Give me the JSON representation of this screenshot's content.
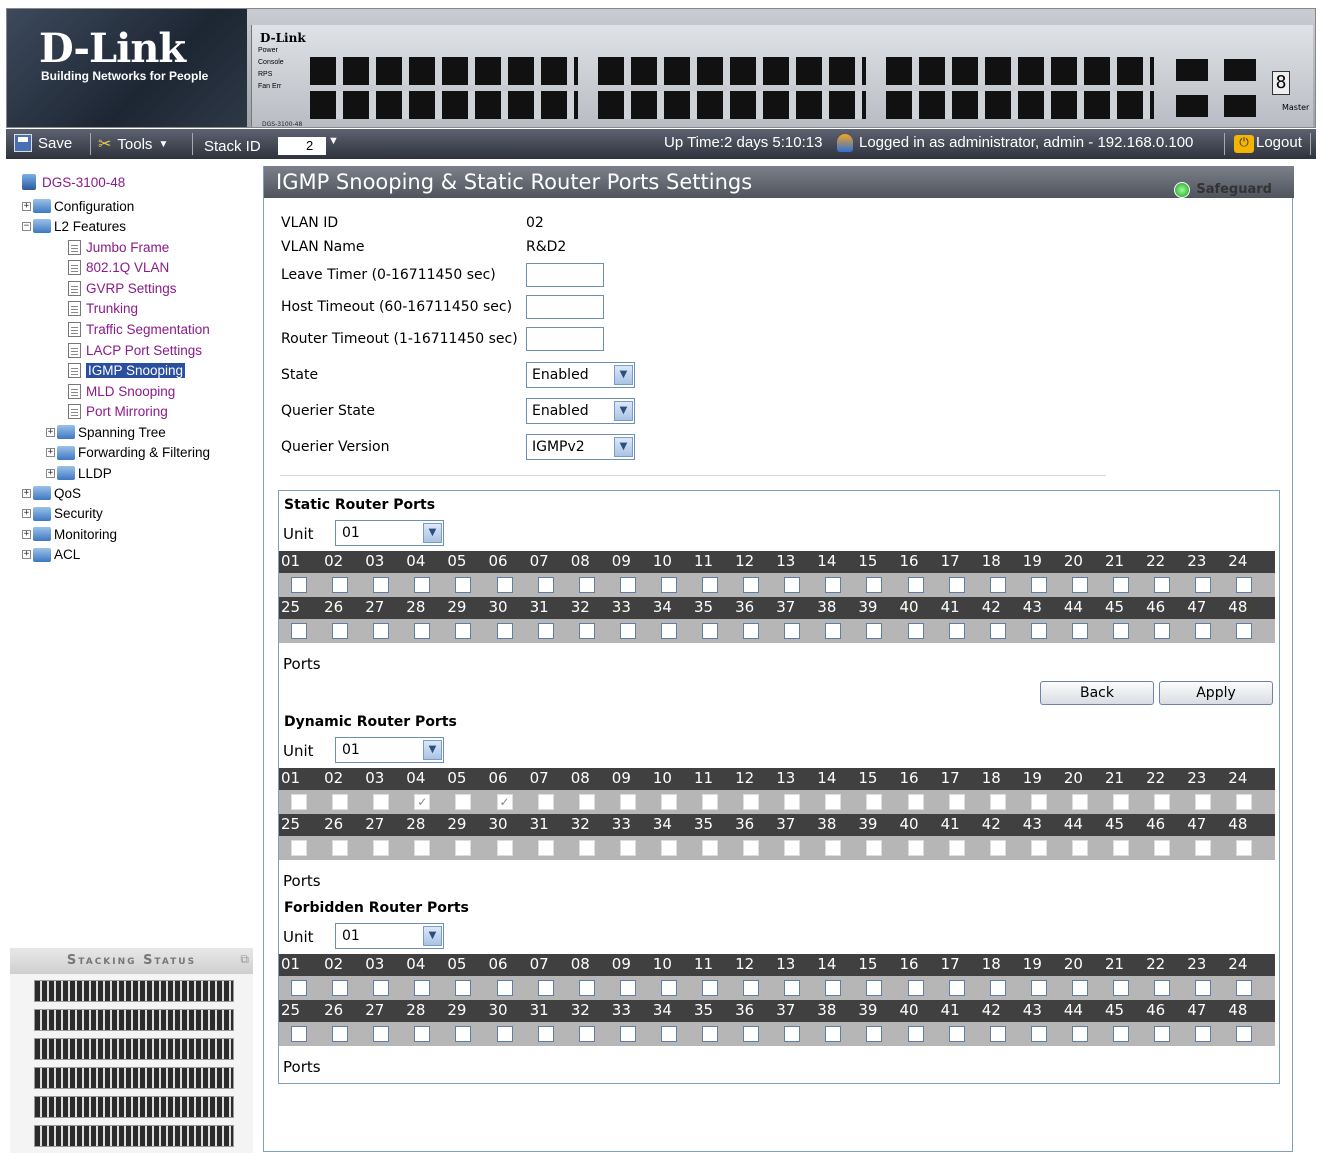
{
  "header": {
    "logo_brand": "D-Link",
    "logo_tagline": "Building Networks for People",
    "switch_brand": "D-Link",
    "switch_model": "DGS-3100-48",
    "led_labels": [
      "Power",
      "Console",
      "RPS",
      "Fan Err"
    ],
    "unit_digit": "8",
    "master_label": "Master"
  },
  "toolbar": {
    "save": "Save",
    "tools": "Tools",
    "stack_id_label": "Stack ID",
    "stack_id_value": "2",
    "uptime": "Up Time:2 days 5:10:13",
    "logged_in": "Logged in as administrator, admin - 192.168.0.100",
    "logout": "Logout"
  },
  "tree": {
    "root": "DGS-3100-48",
    "configuration": "Configuration",
    "l2_features": "L2 Features",
    "leaves": [
      "Jumbo Frame",
      "802.1Q VLAN",
      "GVRP Settings",
      "Trunking",
      "Traffic Segmentation",
      "LACP Port Settings",
      "IGMP Snooping",
      "MLD Snooping",
      "Port Mirroring"
    ],
    "selected_leaf": "IGMP Snooping",
    "l2_subfolders": [
      "Spanning Tree",
      "Forwarding & Filtering",
      "LLDP"
    ],
    "top_folders": [
      "QoS",
      "Security",
      "Monitoring",
      "ACL"
    ]
  },
  "stacking": {
    "title": "Stacking Status",
    "unit_count": 6
  },
  "main": {
    "title": "IGMP Snooping & Static Router Ports Settings",
    "safeguard": "Safeguard",
    "vlan_id_label": "VLAN ID",
    "vlan_id": "02",
    "vlan_name_label": "VLAN Name",
    "vlan_name": "R&D2",
    "leave_timer_label": "Leave Timer (0-16711450 sec)",
    "leave_timer": "",
    "host_timeout_label": "Host Timeout (60-16711450 sec)",
    "host_timeout": "",
    "router_timeout_label": "Router Timeout (1-16711450 sec)",
    "router_timeout": "",
    "state_label": "State",
    "state": "Enabled",
    "querier_state_label": "Querier State",
    "querier_state": "Enabled",
    "querier_version_label": "Querier Version",
    "querier_version": "IGMPv2"
  },
  "ports": {
    "unit_label": "Unit",
    "ports_label": "Ports",
    "back": "Back",
    "apply": "Apply",
    "row1": [
      "01",
      "02",
      "03",
      "04",
      "05",
      "06",
      "07",
      "08",
      "09",
      "10",
      "11",
      "12",
      "13",
      "14",
      "15",
      "16",
      "17",
      "18",
      "19",
      "20",
      "21",
      "22",
      "23",
      "24"
    ],
    "row2": [
      "25",
      "26",
      "27",
      "28",
      "29",
      "30",
      "31",
      "32",
      "33",
      "34",
      "35",
      "36",
      "37",
      "38",
      "39",
      "40",
      "41",
      "42",
      "43",
      "44",
      "45",
      "46",
      "47",
      "48"
    ],
    "sections": [
      {
        "key": "static",
        "title": "Static Router Ports",
        "unit": "01",
        "disabled": false,
        "checked": []
      },
      {
        "key": "dynamic",
        "title": "Dynamic Router Ports",
        "unit": "01",
        "disabled": true,
        "checked": [
          "04",
          "06"
        ]
      },
      {
        "key": "forbidden",
        "title": "Forbidden Router Ports",
        "unit": "01",
        "disabled": false,
        "checked": []
      }
    ]
  }
}
